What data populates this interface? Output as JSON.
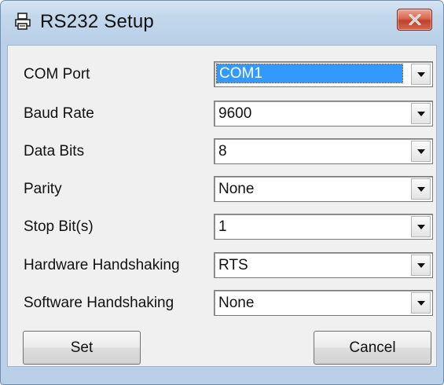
{
  "window": {
    "title": "RS232 Setup",
    "icons": {
      "app": "printer-icon",
      "close": "close-icon"
    },
    "colors": {
      "selection": "#3399ff",
      "close_button": "#c74532",
      "frame": "#b9d0e8"
    }
  },
  "fields": [
    {
      "label": "COM Port",
      "value": "COM1"
    },
    {
      "label": "Baud Rate",
      "value": "9600"
    },
    {
      "label": "Data Bits",
      "value": "8"
    },
    {
      "label": "Parity",
      "value": "None"
    },
    {
      "label": "Stop Bit(s)",
      "value": "1"
    },
    {
      "label": "Hardware Handshaking",
      "value": "RTS"
    },
    {
      "label": "Software Handshaking",
      "value": "None"
    }
  ],
  "buttons": {
    "set": "Set",
    "cancel": "Cancel"
  }
}
